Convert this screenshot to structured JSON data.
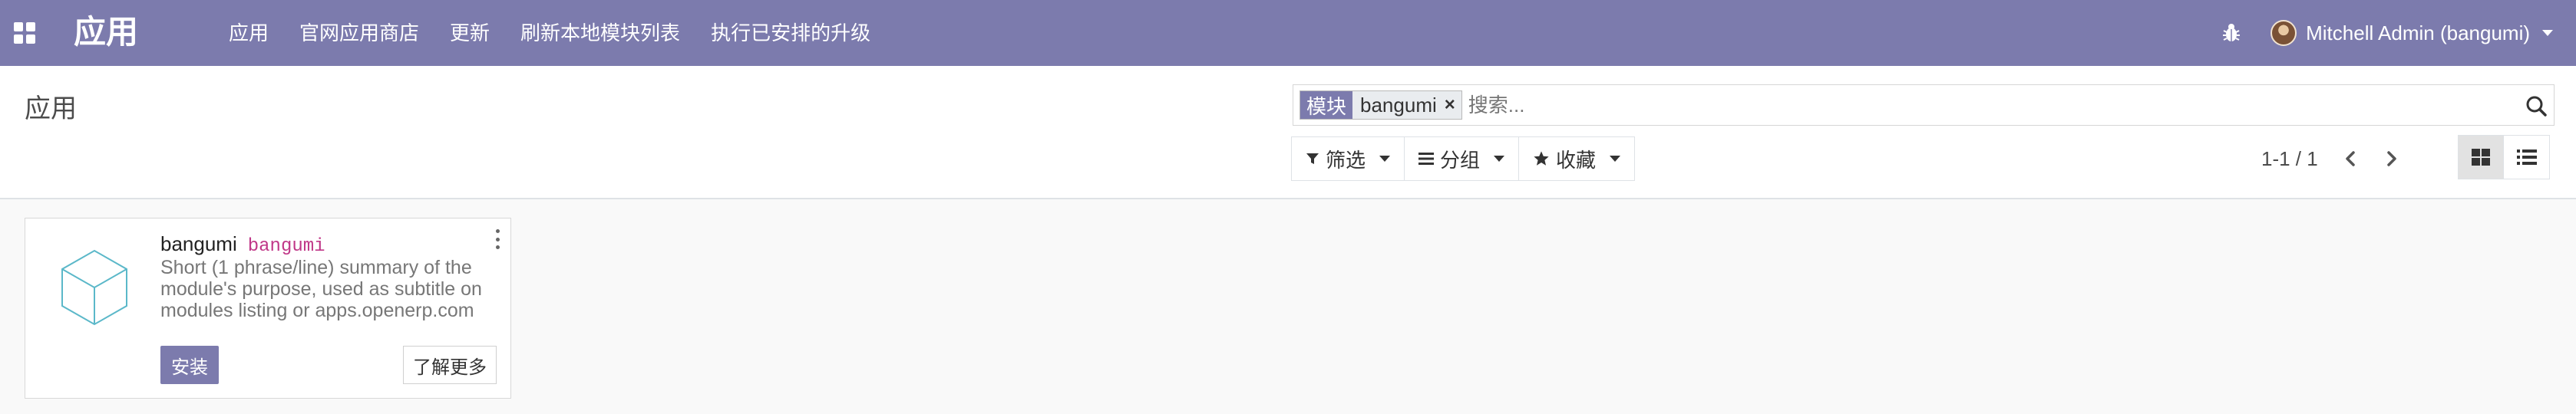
{
  "navbar": {
    "brand": "应用",
    "menu": [
      {
        "label": "应用"
      },
      {
        "label": "官网应用商店"
      },
      {
        "label": "更新"
      },
      {
        "label": "刷新本地模块列表"
      },
      {
        "label": "执行已安排的升级"
      }
    ],
    "user_name": "Mitchell Admin (bangumi)",
    "icons": {
      "apps": "grid-icon",
      "debug": "bug-icon",
      "user": "avatar"
    }
  },
  "control_panel": {
    "title": "应用",
    "search": {
      "facet_label": "模块",
      "facet_value": "bangumi",
      "facet_remove": "×",
      "placeholder": "搜索..."
    },
    "buttons": {
      "filter": "筛选",
      "group": "分组",
      "favorites": "收藏"
    },
    "pager": "1-1 / 1"
  },
  "module_card": {
    "name": "bangumi",
    "technical_name": "bangumi",
    "summary": "Short (1 phrase/line) summary of the module's purpose, used as subtitle on modules listing or apps.openerp.com",
    "install_label": "安装",
    "learn_more_label": "了解更多"
  },
  "colors": {
    "navbar": "#7c7bad",
    "primary": "#7c7bad",
    "technical_name": "#c03788"
  }
}
